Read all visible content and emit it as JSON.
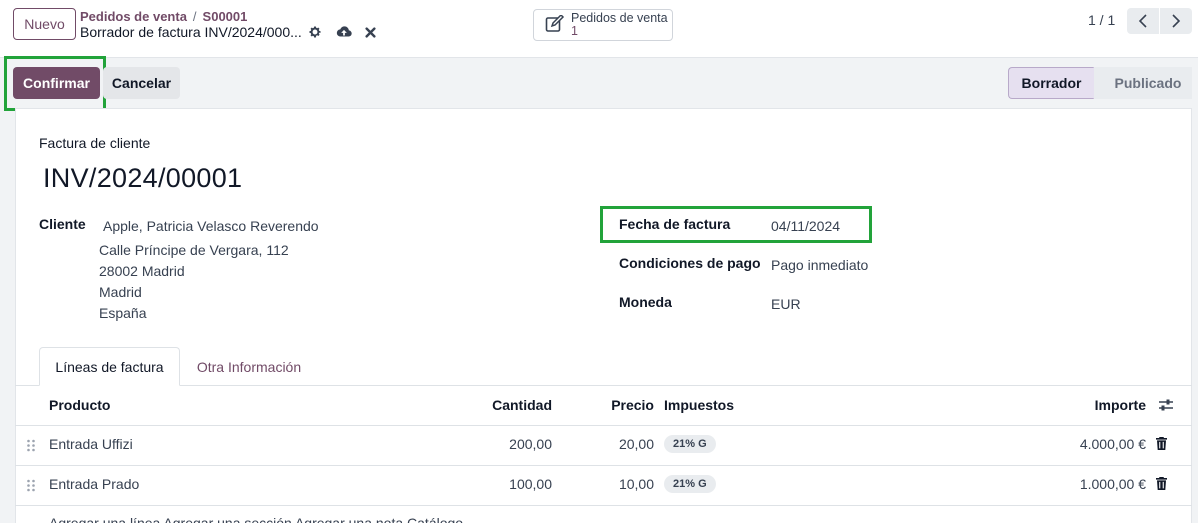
{
  "control_panel": {
    "new_button": "Nuevo",
    "breadcrumb": {
      "parent": "Pedidos de venta",
      "separator": "/",
      "current": "S00001"
    },
    "record_title": "Borrador de factura INV/2024/000...",
    "smart_button": {
      "label": "Pedidos de venta",
      "value": "1",
      "icon": "edit-icon"
    },
    "pager": "1 / 1"
  },
  "statusbar": {
    "confirm_label": "Confirmar",
    "cancel_label": "Cancelar",
    "stages": [
      "Borrador",
      "Publicado"
    ],
    "active_stage": "Borrador"
  },
  "form": {
    "document_type": "Factura de cliente",
    "document_name": "INV/2024/00001",
    "customer_label": "Cliente",
    "customer_name": "Apple, Patricia Velasco Reverendo",
    "customer_address": [
      "Calle Príncipe de Vergara, 112",
      "28002 Madrid",
      "Madrid",
      "España"
    ],
    "invoice_date_label": "Fecha de factura",
    "invoice_date": "04/11/2024",
    "payment_terms_label": "Condiciones de pago",
    "payment_terms": "Pago inmediato",
    "currency_label": "Moneda",
    "currency": "EUR"
  },
  "tabs": [
    {
      "label": "Líneas de factura",
      "active": true
    },
    {
      "label": "Otra Información",
      "active": false
    }
  ],
  "table": {
    "headers": {
      "product": "Producto",
      "quantity": "Cantidad",
      "price": "Precio",
      "taxes": "Impuestos",
      "amount": "Importe"
    },
    "rows": [
      {
        "product": "Entrada Uffizi",
        "quantity": "200,00",
        "price": "20,00",
        "tax": "21% G",
        "amount": "4.000,00 €"
      },
      {
        "product": "Entrada Prado",
        "quantity": "100,00",
        "price": "10,00",
        "tax": "21% G",
        "amount": "1.000,00 €"
      }
    ],
    "footer_partial": "Agregar una línea   Agregar una sección   Agregar una nota   Catálogo"
  },
  "colors": {
    "brand": "#714b67",
    "highlight": "#22a33a"
  }
}
